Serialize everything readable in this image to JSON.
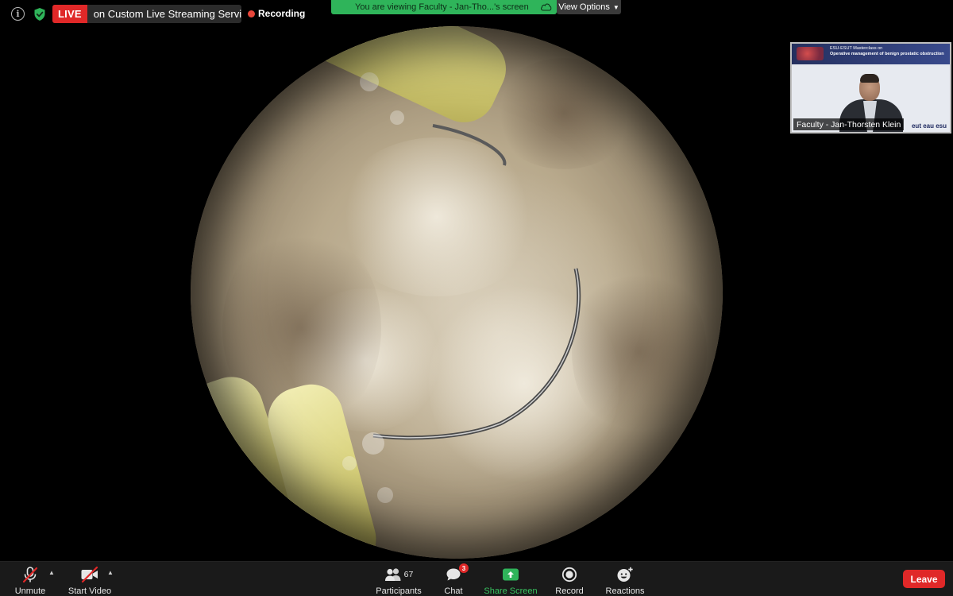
{
  "topbar": {
    "live_badge": "LIVE",
    "live_service": "on Custom Live Streaming Service",
    "recording_label": "Recording",
    "viewing_text": "You are viewing Faculty - Jan-Tho...'s screen",
    "view_options_label": "View Options"
  },
  "speaker": {
    "name": "Faculty - Jan-Thorsten Klein",
    "slide_line1": "ESU-ESUT Masterclass on",
    "slide_line2": "Operative management of benign prostatic obstruction",
    "logos_text": "eut eau esu"
  },
  "toolbar": {
    "unmute_label": "Unmute",
    "start_video_label": "Start Video",
    "participants_label": "Participants",
    "participants_count": "67",
    "chat_label": "Chat",
    "chat_badge": "3",
    "share_label": "Share Screen",
    "record_label": "Record",
    "reactions_label": "Reactions",
    "leave_label": "Leave"
  },
  "colors": {
    "live_red": "#e02828",
    "share_green": "#38c25f",
    "viewing_banner_green": "#2fb45a",
    "toolbar_bg": "#1a1a1a"
  },
  "icons": {
    "info": "info-icon",
    "security": "shield-icon",
    "mic": "mic-muted-icon",
    "video": "video-off-icon",
    "participants": "people-icon",
    "chat": "chat-bubble-icon",
    "share": "share-screen-icon",
    "record": "record-icon",
    "reactions": "emoji-icon",
    "cloud": "cloud-icon"
  }
}
